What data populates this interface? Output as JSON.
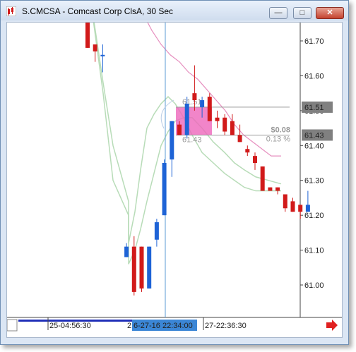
{
  "window": {
    "title": "S.CMCSA - Comcast Corp ClsA, 30 Sec",
    "min_glyph": "—",
    "max_glyph": "□",
    "close_glyph": "✕"
  },
  "colors": {
    "up_candle": "#1e63d6",
    "down_candle": "#d11a1a",
    "moving_average_pink": "#e68fbf",
    "bands_green": "#b8dcb8",
    "crosshair": "#5b9bd5",
    "box_fill": "#ee66bb",
    "price_flag_bg": "#808080"
  },
  "price_axis": {
    "labels": [
      "61.70",
      "61.60",
      "61.50",
      "61.40",
      "61.30",
      "61.20",
      "61.10",
      "61.00"
    ],
    "flags": [
      "61.51",
      "61.43"
    ]
  },
  "time_axis": {
    "labels": [
      "25-04:56:30",
      "27-22:36:30"
    ],
    "partial_label": "2",
    "crosshair_label": "6-27-16 22:34:00"
  },
  "measure": {
    "upper_price": "61.51",
    "lower_price": "61.43",
    "diff": "$0.08",
    "percent": "0.13 %"
  },
  "chart_data": {
    "type": "candlestick",
    "ylim": [
      60.93,
      61.75
    ],
    "candles": [
      {
        "o": 61.77,
        "h": 61.77,
        "l": 61.68,
        "c": 61.68
      },
      {
        "o": 61.69,
        "h": 61.69,
        "l": 61.64,
        "c": 61.67
      },
      {
        "o": 61.66,
        "h": 61.69,
        "l": 61.61,
        "c": 61.66
      },
      {
        "o": 61.08,
        "h": 61.12,
        "l": 61.08,
        "c": 61.11
      },
      {
        "o": 61.11,
        "h": 61.14,
        "l": 60.97,
        "c": 60.98
      },
      {
        "o": 61.11,
        "h": 61.11,
        "l": 60.98,
        "c": 60.99
      },
      {
        "o": 60.99,
        "h": 61.11,
        "l": 60.99,
        "c": 61.11
      },
      {
        "o": 61.13,
        "h": 61.19,
        "l": 61.11,
        "c": 61.18
      },
      {
        "o": 61.2,
        "h": 61.36,
        "l": 61.2,
        "c": 61.35
      },
      {
        "o": 61.36,
        "h": 61.47,
        "l": 61.31,
        "c": 61.47
      },
      {
        "o": 61.46,
        "h": 61.47,
        "l": 61.43,
        "c": 61.43
      },
      {
        "o": 61.43,
        "h": 61.54,
        "l": 61.42,
        "c": 61.52
      },
      {
        "o": 61.55,
        "h": 61.63,
        "l": 61.5,
        "c": 61.53
      },
      {
        "o": 61.51,
        "h": 61.54,
        "l": 61.48,
        "c": 61.53
      },
      {
        "o": 61.54,
        "h": 61.55,
        "l": 61.47,
        "c": 61.47
      },
      {
        "o": 61.48,
        "h": 61.5,
        "l": 61.45,
        "c": 61.47
      },
      {
        "o": 61.48,
        "h": 61.49,
        "l": 61.43,
        "c": 61.44
      },
      {
        "o": 61.47,
        "h": 61.49,
        "l": 61.43,
        "c": 61.43
      },
      {
        "o": 61.43,
        "h": 61.46,
        "l": 61.41,
        "c": 61.41
      },
      {
        "o": 61.39,
        "h": 61.4,
        "l": 61.37,
        "c": 61.38
      },
      {
        "o": 61.37,
        "h": 61.38,
        "l": 61.33,
        "c": 61.35
      },
      {
        "o": 61.34,
        "h": 61.34,
        "l": 61.27,
        "c": 61.27
      },
      {
        "o": 61.28,
        "h": 61.28,
        "l": 61.27,
        "c": 61.27
      },
      {
        "o": 61.28,
        "h": 61.28,
        "l": 61.26,
        "c": 61.27
      },
      {
        "o": 61.26,
        "h": 61.26,
        "l": 61.21,
        "c": 61.22
      },
      {
        "o": 61.24,
        "h": 61.25,
        "l": 61.21,
        "c": 61.21
      },
      {
        "o": 61.23,
        "h": 61.23,
        "l": 61.19,
        "c": 61.21
      },
      {
        "o": 61.21,
        "h": 61.27,
        "l": 61.21,
        "c": 61.23
      }
    ],
    "moving_average": [
      61.78,
      61.73,
      61.69,
      61.66,
      61.64,
      61.61,
      61.59,
      61.56,
      61.53,
      61.5,
      61.46,
      61.43,
      61.41,
      61.39,
      61.37,
      61.37
    ],
    "band_upper": [
      61.12,
      61.21,
      61.33,
      61.45,
      61.49,
      61.52,
      61.54,
      61.52,
      61.48,
      61.43,
      61.38,
      61.35,
      61.32,
      61.3,
      61.28,
      61.27,
      61.27
    ],
    "band_lower": [
      61.06,
      61.1,
      61.16,
      61.24,
      61.32,
      61.4,
      61.44,
      61.47,
      61.48,
      61.48,
      61.45,
      61.41,
      61.38,
      61.35,
      61.33,
      61.31,
      61.29
    ],
    "band_tail_upper": [
      61.76,
      61.55,
      61.3,
      61.2
    ],
    "band_tail_lower": [
      61.77,
      61.58,
      61.4,
      61.24
    ]
  }
}
